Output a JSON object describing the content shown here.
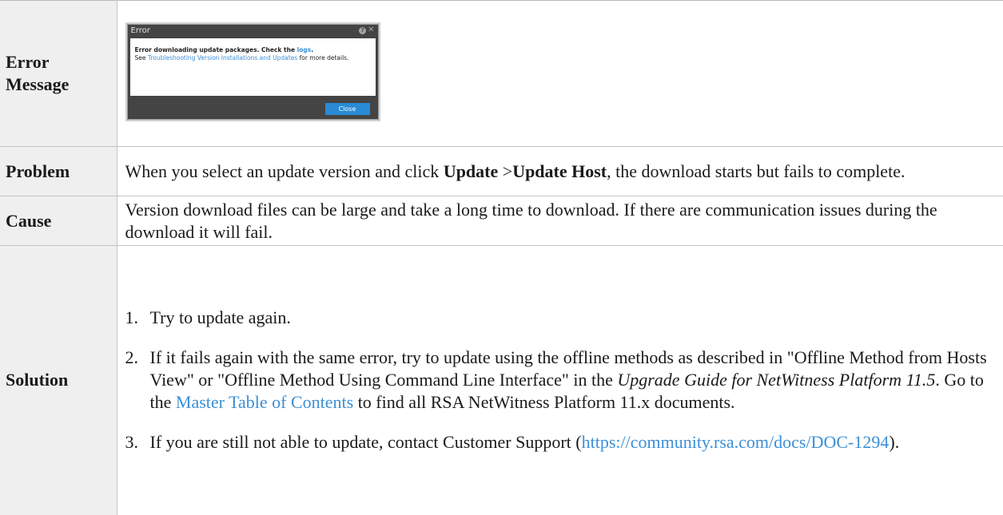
{
  "rows": {
    "error_message": {
      "label_line1": "Error",
      "label_line2": "Message",
      "dialog": {
        "title": "Error",
        "msg_bold_prefix": "Error downloading update packages. Check the ",
        "msg_link": "logs",
        "msg_bold_suffix": ".",
        "see_prefix": "See ",
        "see_link": "Troubleshooting Version Installations and Updates",
        "see_suffix": " for more details.",
        "close_label": "Close"
      }
    },
    "problem": {
      "label": "Problem",
      "text_1": "When you select an update version and click ",
      "bold_1": "Update",
      "text_2": " >",
      "bold_2": "Update Host",
      "text_3": ", the download starts but fails to complete."
    },
    "cause": {
      "label": "Cause",
      "text": "Version download files can be large and take a long time to download. If there are communication issues during the download it will fail."
    },
    "solution": {
      "label": "Solution",
      "steps": [
        {
          "num": "1.",
          "text": "Try to update again."
        },
        {
          "num": "2.",
          "text_1": "If it fails again with the same error, try to update using the offline methods as described in \"Offline Method from Hosts View\" or \"Offline Method Using Command Line Interface\" in the ",
          "italic": "Upgrade Guide for NetWitness Platform 11.5",
          "text_2": ". Go to the ",
          "link": "Master Table of Contents",
          "text_3": " to find all RSA NetWitness Platform 11.x documents."
        },
        {
          "num": "3.",
          "text_1": "If you are still not able to update, contact Customer Support (",
          "link": "https://community.rsa.com/docs/DOC-1294",
          "text_2": ")."
        }
      ]
    }
  },
  "colors": {
    "link": "#3b8fd6",
    "label_bg": "#efefef",
    "dialog_bg": "#444444",
    "button": "#2a8ad4"
  }
}
